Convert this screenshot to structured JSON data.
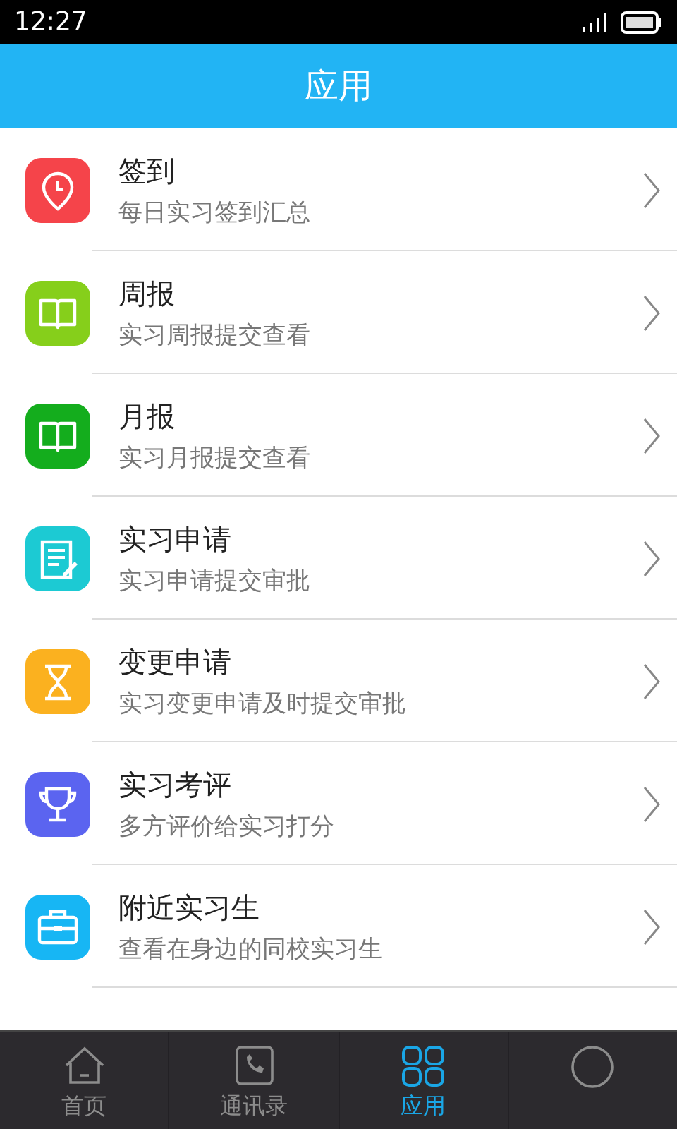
{
  "status_bar": {
    "time": "12:27"
  },
  "header": {
    "title": "应用"
  },
  "items": [
    {
      "kind": "pin",
      "color": "#f5444a",
      "title": "签到",
      "subtitle": "每日实习签到汇总"
    },
    {
      "kind": "book",
      "color": "#86cf1b",
      "title": "周报",
      "subtitle": "实习周报提交查看"
    },
    {
      "kind": "book",
      "color": "#14ad1d",
      "title": "月报",
      "subtitle": "实习月报提交查看"
    },
    {
      "kind": "document",
      "color": "#1ccad3",
      "title": "实习申请",
      "subtitle": "实习申请提交审批"
    },
    {
      "kind": "hourglass",
      "color": "#fbb11f",
      "title": "变更申请",
      "subtitle": "实习变更申请及时提交审批"
    },
    {
      "kind": "trophy",
      "color": "#5b64f0",
      "title": "实习考评",
      "subtitle": "多方评价给实习打分"
    },
    {
      "kind": "briefcase",
      "color": "#17b6f4",
      "title": "附近实习生",
      "subtitle": "查看在身边的同校实习生"
    }
  ],
  "tabs": [
    {
      "kind": "home",
      "label": "首页",
      "selected": false
    },
    {
      "kind": "contacts",
      "label": "通讯录",
      "selected": false
    },
    {
      "kind": "apps",
      "label": "应用",
      "selected": true
    },
    {
      "kind": "circle",
      "selected": false
    }
  ]
}
